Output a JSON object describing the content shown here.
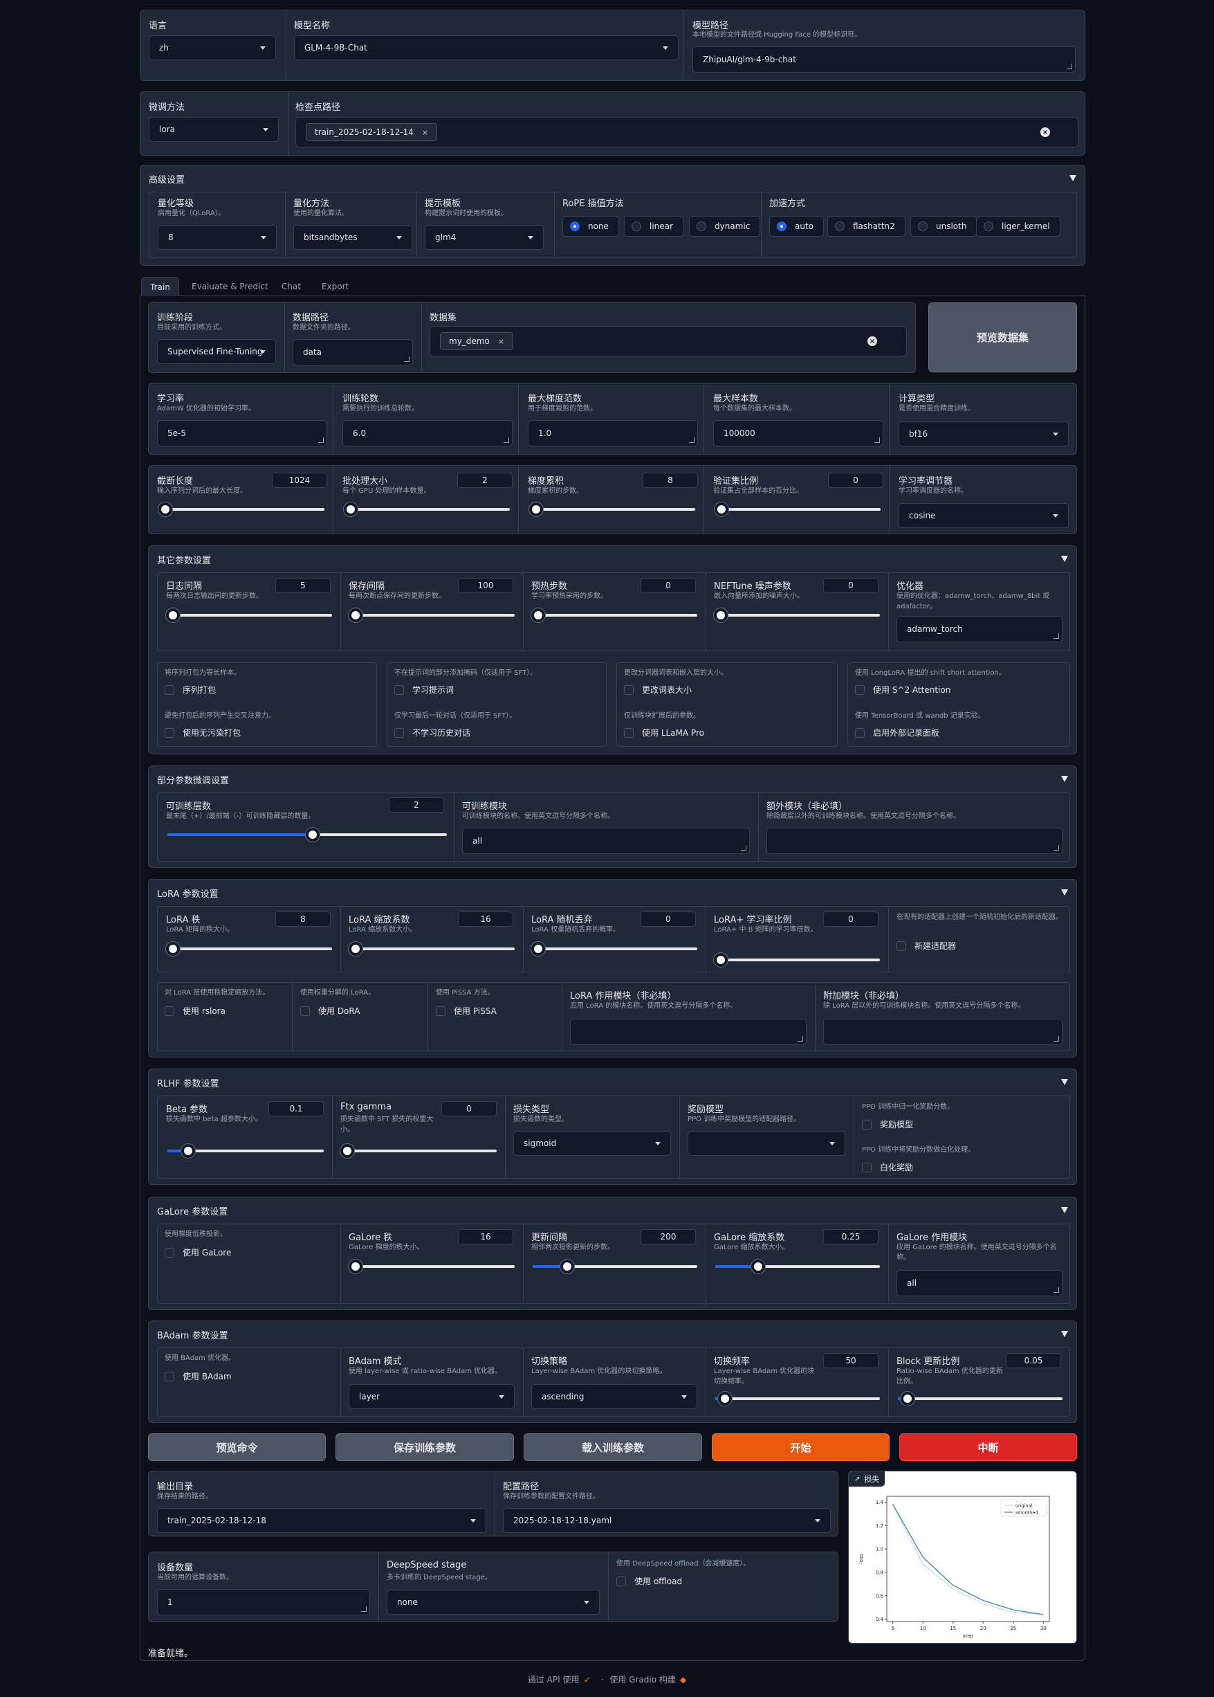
{
  "top": {
    "language": {
      "label": "语言",
      "value": "zh"
    },
    "model_name": {
      "label": "模型名称",
      "value": "GLM-4-9B-Chat"
    },
    "model_path": {
      "label": "模型路径",
      "info": "本地模型的文件路径或 Hugging Face 的模型标识符。",
      "value": "ZhipuAI/glm-4-9b-chat"
    }
  },
  "finetune": {
    "method": {
      "label": "微调方法",
      "value": "lora"
    },
    "checkpoint": {
      "label": "检查点路径",
      "chip": "train_2025-02-18-12-14"
    }
  },
  "advanced": {
    "title": "高级设置",
    "quant_bit": {
      "label": "量化等级",
      "info": "启用量化（QLoRA）。",
      "value": "8"
    },
    "quant_method": {
      "label": "量化方法",
      "info": "使用的量化算法。",
      "value": "bitsandbytes"
    },
    "template": {
      "label": "提示模板",
      "info": "构建提示词时使用的模板。",
      "value": "glm4"
    },
    "rope": {
      "label": "RoPE 插值方法",
      "options": [
        "none",
        "linear",
        "dynamic"
      ],
      "selected": "none"
    },
    "booster": {
      "label": "加速方式",
      "options": [
        "auto",
        "flashattn2",
        "unsloth",
        "liger_kernel"
      ],
      "selected": "auto"
    }
  },
  "tabs": [
    "Train",
    "Evaluate & Predict",
    "Chat",
    "Export"
  ],
  "train": {
    "stage": {
      "label": "训练阶段",
      "info": "目前采用的训练方式。",
      "value": "Supervised Fine-Tuning"
    },
    "dataset_dir": {
      "label": "数据路径",
      "info": "数据文件夹的路径。",
      "value": "data"
    },
    "dataset": {
      "label": "数据集",
      "chip": "my_demo"
    },
    "preview_dataset": "预览数据集",
    "learning_rate": {
      "label": "学习率",
      "info": "AdamW 优化器的初始学习率。",
      "value": "5e-5"
    },
    "epochs": {
      "label": "训练轮数",
      "info": "需要执行的训练总轮数。",
      "value": "6.0"
    },
    "max_grad_norm": {
      "label": "最大梯度范数",
      "info": "用于梯度裁剪的范数。",
      "value": "1.0"
    },
    "max_samples": {
      "label": "最大样本数",
      "info": "每个数据集的最大样本数。",
      "value": "100000"
    },
    "compute_type": {
      "label": "计算类型",
      "info": "是否使用混合精度训练。",
      "value": "bf16"
    },
    "cutoff_len": {
      "label": "截断长度",
      "info": "输入序列分词后的最大长度。",
      "value": "1024"
    },
    "batch_size": {
      "label": "批处理大小",
      "info": "每个 GPU 处理的样本数量。",
      "value": "2"
    },
    "grad_accum": {
      "label": "梯度累积",
      "info": "梯度累积的步数。",
      "value": "8"
    },
    "val_size": {
      "label": "验证集比例",
      "info": "验证集占全部样本的百分比。",
      "value": "0"
    },
    "lr_scheduler": {
      "label": "学习率调节器",
      "info": "学习率调度器的名称。",
      "value": "cosine"
    }
  },
  "other": {
    "title": "其它参数设置",
    "logging_steps": {
      "label": "日志间隔",
      "info": "每两次日志输出间的更新步数。",
      "value": "5"
    },
    "save_steps": {
      "label": "保存间隔",
      "info": "每两次断点保存间的更新步数。",
      "value": "100"
    },
    "warmup_steps": {
      "label": "预热步数",
      "info": "学习率预热采用的步数。",
      "value": "0"
    },
    "neftune": {
      "label": "NEFTune 噪声参数",
      "info": "嵌入向量所添加的噪声大小。",
      "value": "0"
    },
    "optim": {
      "label": "优化器",
      "info": "使用的优化器：adamw_torch、adamw_8bit 或 adafactor。",
      "value": "adamw_torch"
    },
    "packing": {
      "info": "将序列打包为等长样本。",
      "label": "序列打包"
    },
    "neat_packing": {
      "info": "避免打包后的序列产生交叉注意力。",
      "label": "使用无污染打包"
    },
    "train_on_prompt": {
      "info": "不在提示词的部分添加掩码（仅适用于 SFT）。",
      "label": "学习提示词"
    },
    "mask_history": {
      "info": "仅学习最后一轮对话（仅适用于 SFT）。",
      "label": "不学习历史对话"
    },
    "resize_vocab": {
      "info": "更改分词器词表和嵌入层的大小。",
      "label": "更改词表大小"
    },
    "use_llama_pro": {
      "info": "仅训练块扩展后的参数。",
      "label": "使用 LLaMA Pro"
    },
    "shift_attn": {
      "info": "使用 LongLoRA 提出的 shift short attention。",
      "label": "使用 S^2 Attention"
    },
    "report_to": {
      "info": "使用 TensorBoard 或 wandb 记录实验。",
      "label": "启用外部记录面板"
    }
  },
  "freeze": {
    "title": "部分参数微调设置",
    "layers": {
      "label": "可训练层数",
      "info": "最末尾（+）/最前端（-）可训练隐藏层的数量。",
      "value": "2"
    },
    "modules": {
      "label": "可训练模块",
      "info": "可训练模块的名称。使用英文逗号分隔多个名称。",
      "value": "all"
    },
    "extra": {
      "label": "额外模块（非必填）",
      "info": "除隐藏层以外的可训练模块名称。使用英文逗号分隔多个名称。",
      "value": ""
    }
  },
  "lora": {
    "title": "LoRA 参数设置",
    "rank": {
      "label": "LoRA 秩",
      "info": "LoRA 矩阵的秩大小。",
      "value": "8"
    },
    "alpha": {
      "label": "LoRA 缩放系数",
      "info": "LoRA 缩放系数大小。",
      "value": "16"
    },
    "dropout": {
      "label": "LoRA 随机丢弃",
      "info": "LoRA 权重随机丢弃的概率。",
      "value": "0"
    },
    "plus_ratio": {
      "label": "LoRA+ 学习率比例",
      "info": "LoRA+ 中 B 矩阵的学习率倍数。",
      "value": "0"
    },
    "new_adapter": {
      "info": "在现有的适配器上创建一个随机初始化后的新适配器。",
      "label": "新建适配器"
    },
    "rslora": {
      "info": "对 LoRA 层使用秩稳定缩放方法。",
      "label": "使用 rslora"
    },
    "dora": {
      "info": "使用权重分解的 LoRA。",
      "label": "使用 DoRA"
    },
    "pissa": {
      "info": "使用 PiSSA 方法。",
      "label": "使用 PiSSA"
    },
    "target": {
      "label": "LoRA 作用模块（非必填）",
      "info": "应用 LoRA 的模块名称。使用英文逗号分隔多个名称。",
      "value": ""
    },
    "additional": {
      "label": "附加模块（非必填）",
      "info": "除 LoRA 层以外的可训练模块名称。使用英文逗号分隔多个名称。",
      "value": ""
    }
  },
  "rlhf": {
    "title": "RLHF 参数设置",
    "beta": {
      "label": "Beta 参数",
      "info": "损失函数中 beta 超参数大小。",
      "value": "0.1"
    },
    "ftx": {
      "label": "Ftx gamma",
      "info": "损失函数中 SFT 损失的权重大小。",
      "value": "0"
    },
    "loss_type": {
      "label": "损失类型",
      "info": "损失函数的类型。",
      "value": "sigmoid"
    },
    "reward_model": {
      "label": "奖励模型",
      "info": "PPO 训练中奖励模型的适配器路径。",
      "value": ""
    },
    "ppo_score_norm": {
      "info": "PPO 训练中归一化奖励分数。",
      "label": "奖励模型"
    },
    "ppo_whiten": {
      "info": "PPO 训练中将奖励分数做白化处理。",
      "label": "白化奖励"
    }
  },
  "galore": {
    "title": "GaLore 参数设置",
    "use": {
      "info": "使用梯度低秩投影。",
      "label": "使用 GaLore"
    },
    "rank": {
      "label": "GaLore 秩",
      "info": "GaLore 梯度的秩大小。",
      "value": "16"
    },
    "update": {
      "label": "更新间隔",
      "info": "相邻两次投影更新的步数。",
      "value": "200"
    },
    "scale": {
      "label": "GaLore 缩放系数",
      "info": "GaLore 缩放系数大小。",
      "value": "0.25"
    },
    "target": {
      "label": "GaLore 作用模块",
      "info": "应用 GaLore 的模块名称。使用英文逗号分隔多个名称。",
      "value": "all"
    }
  },
  "badam": {
    "title": "BAdam 参数设置",
    "use": {
      "info": "使用 BAdam 优化器。",
      "label": "使用 BAdam"
    },
    "mode": {
      "label": "BAdam 模式",
      "info": "使用 layer-wise 或 ratio-wise BAdam 优化器。",
      "value": "layer"
    },
    "switch_mode": {
      "label": "切换策略",
      "info": "Layer-wise BAdam 优化器的块切换策略。",
      "value": "ascending"
    },
    "switch_interval": {
      "label": "切换频率",
      "info": "Layer-wise BAdam 优化器的块切换频率。",
      "value": "50"
    },
    "update_ratio": {
      "label": "Block 更新比例",
      "info": "Ratio-wise BAdam 优化器的更新比例。",
      "value": "0.05"
    }
  },
  "actions": {
    "preview": "预览命令",
    "save": "保存训练参数",
    "load": "载入训练参数",
    "start": "开始",
    "stop": "中断"
  },
  "output": {
    "output_dir": {
      "label": "输出目录",
      "info": "保存结果的路径。",
      "value": "train_2025-02-18-12-18"
    },
    "config_path": {
      "label": "配置路径",
      "info": "保存训练参数的配置文件路径。",
      "value": "2025-02-18-12-18.yaml"
    },
    "device_count": {
      "label": "设备数量",
      "info": "当前可用的运算设备数。",
      "value": "1"
    },
    "ds_stage": {
      "label": "DeepSpeed stage",
      "info": "多卡训练的 DeepSpeed stage。",
      "value": "none"
    },
    "ds_offload": {
      "info": "使用 DeepSpeed offload（会减缓速度）。",
      "label": "使用 offload"
    },
    "status": "准备就绪。"
  },
  "colors": {
    "accent": "#2563eb",
    "start": "#ea580c",
    "stop": "#dc2626"
  },
  "chart_data": {
    "type": "line",
    "tab_label": "损失",
    "xlabel": "step",
    "ylabel": "loss",
    "xlim": [
      4,
      31
    ],
    "ylim": [
      0.38,
      1.45
    ],
    "xticks": [
      5,
      10,
      15,
      20,
      25,
      30
    ],
    "yticks": [
      0.4,
      0.6,
      0.8,
      1.0,
      1.2,
      1.4
    ],
    "legend_position": "top-right",
    "series": [
      {
        "name": "original",
        "x": [
          5,
          10,
          15,
          20,
          25,
          30
        ],
        "y": [
          1.38,
          0.87,
          0.66,
          0.53,
          0.46,
          0.44
        ],
        "color": "#c7d9e6"
      },
      {
        "name": "smoothed",
        "x": [
          5,
          10,
          15,
          20,
          25,
          30
        ],
        "y": [
          1.38,
          0.93,
          0.69,
          0.56,
          0.48,
          0.44
        ],
        "color": "#4a90b8"
      }
    ]
  },
  "footer": {
    "api": "通过 API 使用",
    "sep": "·",
    "built": "使用 Gradio 构建"
  }
}
